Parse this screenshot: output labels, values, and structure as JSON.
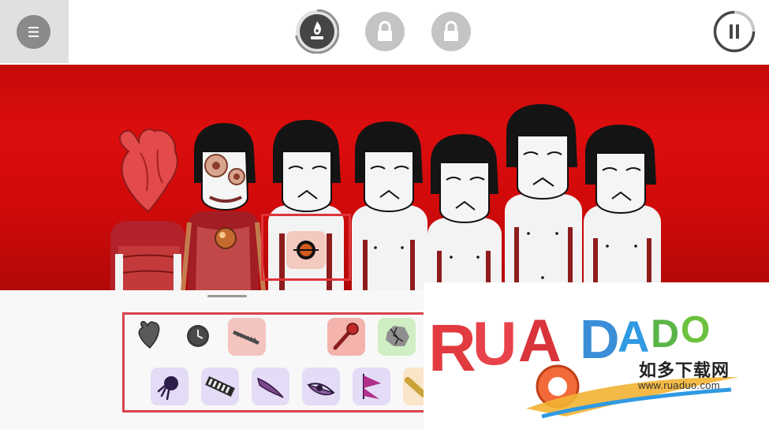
{
  "topbar": {
    "menu_icon": "hamburger-icon",
    "levels": [
      {
        "icon": "flame-icon",
        "state": "unlocked"
      },
      {
        "icon": "lock-icon",
        "state": "locked"
      },
      {
        "icon": "lock-icon",
        "state": "locked"
      }
    ],
    "pause_icon": "pause-icon"
  },
  "stage": {
    "background_color": "#d10a0a",
    "characters": [
      {
        "kind": "heart"
      },
      {
        "kind": "gear-face"
      },
      {
        "kind": "performer",
        "selected": true
      },
      {
        "kind": "performer"
      },
      {
        "kind": "performer"
      },
      {
        "kind": "performer"
      },
      {
        "kind": "performer"
      }
    ],
    "selected_icon": "eye-icon"
  },
  "palette": {
    "row1": [
      {
        "icon": "heart-organ-icon",
        "bg": "none"
      },
      {
        "icon": "clock-icon",
        "bg": "none"
      },
      {
        "icon": "saw-icon",
        "bg": "#f4c4bf"
      },
      {
        "icon": "eye-icon",
        "bg": "none",
        "used": true
      },
      {
        "icon": "microphone-icon",
        "bg": "#f4b3ad"
      },
      {
        "icon": "cracked-stone-icon",
        "bg": "#cfeec3"
      }
    ],
    "row2": [
      {
        "icon": "comet-icon",
        "bg": "#e4dbf6"
      },
      {
        "icon": "keyboard-icon",
        "bg": "#e4dbf6"
      },
      {
        "icon": "claw-icon",
        "bg": "#e4dbf6"
      },
      {
        "icon": "half-eye-icon",
        "bg": "#e4dbf6"
      },
      {
        "icon": "flag-icon",
        "bg": "#e4dbf6"
      },
      {
        "icon": "stick-icon",
        "bg": "#fbe5c8"
      }
    ]
  },
  "watermark": {
    "logo_text": "RUADADO",
    "cn_text": "如多下载网",
    "url": "www.ruaduo.com"
  },
  "colors": {
    "accent_red": "#e0333b",
    "character_red": "#b3212b",
    "lock_grey": "#c4c4c4"
  }
}
